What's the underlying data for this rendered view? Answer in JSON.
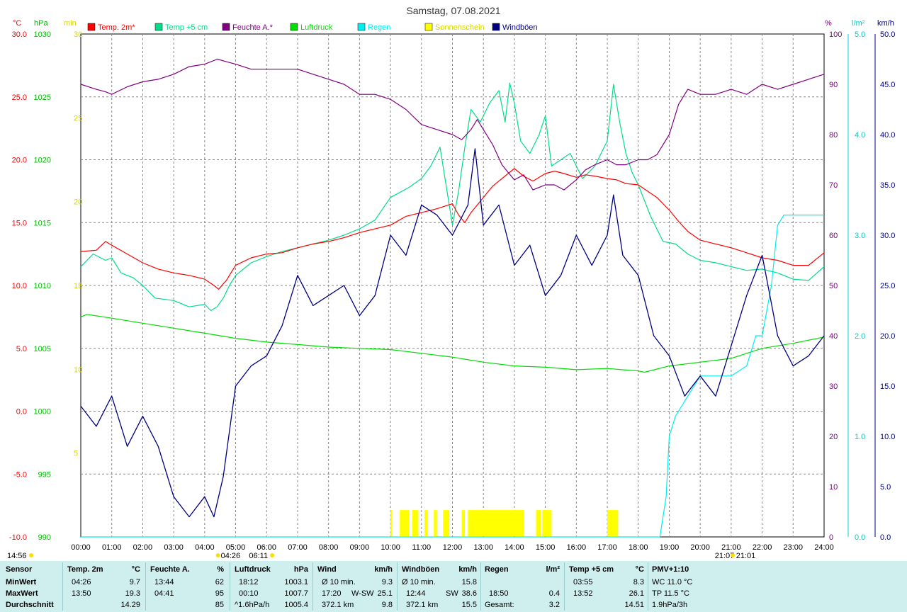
{
  "title": "Samstag, 07.08.2021",
  "colors": {
    "temp2m": "#ff0000",
    "temp5cm": "#00dd88",
    "humidity": "#800080",
    "pressure": "#00dd00",
    "rain": "#00eeee",
    "sunshine": "#ffff00",
    "gusts": "#000080"
  },
  "legend": [
    {
      "label": "Temp. 2m*",
      "color": "#ff0000"
    },
    {
      "label": "Temp +5 cm",
      "color": "#00dd88"
    },
    {
      "label": "Feuchte A.*",
      "color": "#800080"
    },
    {
      "label": "Luftdruck",
      "color": "#00dd00"
    },
    {
      "label": "Regen",
      "color": "#00eeee"
    },
    {
      "label": "Sonnenschein",
      "color": "#ffff00"
    },
    {
      "label": "Windböen",
      "color": "#000080"
    }
  ],
  "axes": {
    "temp": {
      "unit": "°C",
      "ticks": [
        "30.0",
        "25.0",
        "20.0",
        "15.0",
        "10.0",
        "5.0",
        "0.0",
        "-5.0",
        "-10.0"
      ],
      "range": [
        -10,
        30
      ]
    },
    "pressure": {
      "unit": "hPa",
      "ticks": [
        "1030",
        "1025",
        "1020",
        "1015",
        "1010",
        "1005",
        "1000",
        "995",
        "990"
      ],
      "range": [
        990,
        1030
      ]
    },
    "sun_min": {
      "unit": "min",
      "ticks": [
        "30",
        "25",
        "20",
        "15",
        "10",
        "5"
      ],
      "range": [
        0,
        30
      ]
    },
    "humidity": {
      "unit": "%",
      "ticks": [
        "100",
        "90",
        "80",
        "70",
        "60",
        "50",
        "40",
        "30",
        "20",
        "10",
        "0"
      ],
      "range": [
        0,
        100
      ]
    },
    "rain": {
      "unit": "l/m²",
      "ticks": [
        "5.0",
        "4.0",
        "3.0",
        "2.0",
        "1.0",
        "0.0"
      ],
      "range": [
        0,
        5
      ]
    },
    "wind": {
      "unit": "km/h",
      "ticks": [
        "50.0",
        "45.0",
        "40.0",
        "35.0",
        "30.0",
        "25.0",
        "20.0",
        "15.0",
        "10.0",
        "5.0",
        "0.0"
      ],
      "range": [
        0,
        50
      ]
    },
    "time_ticks": [
      "00:00",
      "01:00",
      "02:00",
      "03:00",
      "04:00",
      "05:00",
      "06:00",
      "07:00",
      "08:00",
      "09:00",
      "10:00",
      "11:00",
      "12:00",
      "13:00",
      "14:00",
      "15:00",
      "16:00",
      "17:00",
      "18:00",
      "19:00",
      "20:00",
      "21:00",
      "22:00",
      "23:00",
      "24:00"
    ]
  },
  "time_markers": {
    "left": "14:56",
    "sunrise_a": "04:26",
    "sunrise_b": "06:11",
    "sunset_a": "21:07",
    "sunset_b": "21:01"
  },
  "chart_data": {
    "type": "line",
    "x_unit": "hours",
    "series": [
      {
        "name": "Temp. 2m*",
        "unit": "°C",
        "x": [
          0,
          0.5,
          0.8,
          1,
          1.5,
          2,
          2.5,
          3,
          3.5,
          4,
          4.3,
          4.45,
          4.7,
          5,
          5.5,
          6,
          6.5,
          7,
          7.5,
          8,
          8.5,
          9,
          9.5,
          10,
          10.5,
          11,
          11.5,
          12,
          12.2,
          12.4,
          12.6,
          13,
          13.3,
          13.6,
          14,
          14.3,
          14.6,
          15,
          15.3,
          15.6,
          16,
          16.3,
          16.6,
          17,
          17.3,
          17.6,
          18,
          18.3,
          18.6,
          19,
          19.3,
          19.6,
          20,
          20.5,
          21,
          21.5,
          22,
          22.5,
          23,
          23.5,
          24
        ],
        "y": [
          12.7,
          12.8,
          13.5,
          13.2,
          12.5,
          11.8,
          11.3,
          11.0,
          10.8,
          10.5,
          10.0,
          9.7,
          10.4,
          11.6,
          12.2,
          12.5,
          12.6,
          13.0,
          13.3,
          13.5,
          13.8,
          14.2,
          14.5,
          14.8,
          15.5,
          15.8,
          16.1,
          16.5,
          15.6,
          15.0,
          15.8,
          17.0,
          17.9,
          18.5,
          19.3,
          18.7,
          18.3,
          18.9,
          19.1,
          18.9,
          18.6,
          18.8,
          18.7,
          18.5,
          18.4,
          18.1,
          18.0,
          17.5,
          17.0,
          16.0,
          15.1,
          14.3,
          13.6,
          13.3,
          13.0,
          12.6,
          12.2,
          12.0,
          11.6,
          11.6,
          12.6
        ]
      },
      {
        "name": "Temp +5 cm",
        "unit": "°C",
        "x": [
          0,
          0.4,
          0.8,
          1,
          1.3,
          1.7,
          2,
          2.4,
          3,
          3.5,
          4,
          4.2,
          4.4,
          4.6,
          4.8,
          5,
          5.5,
          6,
          6.5,
          7,
          7.5,
          8,
          8.5,
          9,
          9.5,
          10,
          10.3,
          10.6,
          11,
          11.3,
          11.6,
          12,
          12.2,
          12.4,
          12.6,
          12.9,
          13.2,
          13.5,
          13.7,
          13.85,
          14,
          14.2,
          14.5,
          14.8,
          15,
          15.2,
          15.5,
          15.8,
          16.2,
          16.6,
          17,
          17.2,
          17.4,
          17.6,
          17.8,
          18,
          18.4,
          18.8,
          19.2,
          19.6,
          20,
          20.5,
          21,
          21.5,
          22,
          22.5,
          23,
          23.5,
          24
        ],
        "y": [
          11.5,
          12.5,
          12.0,
          12.2,
          11.0,
          10.6,
          10.0,
          9.0,
          8.8,
          8.3,
          8.5,
          8.0,
          8.3,
          9.0,
          10.0,
          10.8,
          11.8,
          12.3,
          12.7,
          13.0,
          13.3,
          13.6,
          14.0,
          14.5,
          15.2,
          17.0,
          17.4,
          17.8,
          18.5,
          19.5,
          21.0,
          14.8,
          17.5,
          21.0,
          24.0,
          23.0,
          24.5,
          25.5,
          23.0,
          26.1,
          24.5,
          21.5,
          20.5,
          22.0,
          23.5,
          19.5,
          20.0,
          20.5,
          18.5,
          19.5,
          21.5,
          26.0,
          23.0,
          20.5,
          19.0,
          18.0,
          15.5,
          13.5,
          13.3,
          12.5,
          12.0,
          11.8,
          11.5,
          11.2,
          11.3,
          11.0,
          10.5,
          10.4,
          11.5
        ]
      },
      {
        "name": "Feuchte A.*",
        "unit": "%",
        "x": [
          0,
          0.5,
          0.8,
          1,
          1.5,
          2,
          2.5,
          3,
          3.5,
          4,
          4.41,
          4.7,
          5,
          5.5,
          6,
          6.5,
          7,
          7.5,
          8,
          8.5,
          9,
          9.5,
          10,
          10.5,
          11,
          11.5,
          12,
          12.3,
          12.6,
          12.8,
          13,
          13.3,
          13.6,
          13.73,
          14,
          14.3,
          14.6,
          15,
          15.3,
          15.6,
          16,
          16.3,
          16.6,
          17,
          17.3,
          17.6,
          18,
          18.3,
          18.6,
          19,
          19.3,
          19.6,
          20,
          20.5,
          21,
          21.5,
          22,
          22.5,
          23,
          23.5,
          24
        ],
        "y": [
          90,
          89,
          88.5,
          88,
          89.5,
          90.5,
          91,
          92,
          93.5,
          94,
          95,
          94.5,
          94,
          93,
          93,
          93,
          93,
          92,
          91,
          90,
          88,
          88,
          87,
          85,
          82,
          81,
          80,
          79,
          81,
          83,
          81,
          78,
          74,
          73,
          71,
          72,
          69,
          70,
          70,
          69,
          71,
          73,
          74,
          75,
          74,
          74,
          75,
          75,
          76,
          80,
          86,
          89,
          88,
          88,
          89,
          88,
          90,
          89,
          90,
          91,
          92
        ]
      },
      {
        "name": "Luftdruck",
        "unit": "hPa",
        "x": [
          0,
          0.2,
          1,
          2,
          3,
          4,
          5,
          6,
          7,
          8,
          9,
          10,
          11,
          12,
          13,
          14,
          15,
          16,
          17,
          18,
          18.2,
          19,
          20,
          21,
          22,
          23,
          24
        ],
        "y": [
          1007.5,
          1007.7,
          1007.4,
          1007.0,
          1006.6,
          1006.2,
          1005.8,
          1005.5,
          1005.3,
          1005.1,
          1005.0,
          1004.9,
          1004.6,
          1004.3,
          1003.9,
          1003.6,
          1003.5,
          1003.3,
          1003.4,
          1003.2,
          1003.1,
          1003.6,
          1003.9,
          1004.2,
          1005.0,
          1005.4,
          1005.9
        ]
      },
      {
        "name": "Regen",
        "unit": "l/m²",
        "x": [
          0,
          18.7,
          18.8,
          18.9,
          19.0,
          19.2,
          20.0,
          20.5,
          21.0,
          21.5,
          21.8,
          22.0,
          22.3,
          22.5,
          22.7,
          23.0,
          24.0
        ],
        "y": [
          0,
          0,
          0.2,
          0.4,
          1.0,
          1.2,
          1.6,
          1.6,
          1.6,
          1.7,
          2.0,
          2.0,
          2.5,
          3.1,
          3.2,
          3.2,
          3.2
        ]
      },
      {
        "name": "Windböen",
        "unit": "km/h",
        "x": [
          0,
          0.5,
          1,
          1.5,
          2,
          2.5,
          3,
          3.5,
          4,
          4.3,
          4.6,
          5,
          5.5,
          6,
          6.5,
          7,
          7.5,
          8,
          8.5,
          9,
          9.5,
          10,
          10.5,
          11,
          11.5,
          12,
          12.5,
          12.73,
          13,
          13.5,
          14,
          14.5,
          15,
          15.5,
          16,
          16.5,
          17,
          17.2,
          17.5,
          18,
          18.5,
          19,
          19.5,
          20,
          20.5,
          21,
          21.5,
          22,
          22.5,
          23,
          23.5,
          24
        ],
        "y": [
          13,
          11,
          14,
          9,
          12,
          9,
          4,
          2,
          4,
          2,
          6,
          15,
          17,
          18,
          21,
          26,
          23,
          24,
          25,
          22,
          24,
          30,
          28,
          33,
          32,
          30,
          33,
          38.6,
          31,
          33,
          27,
          29,
          24,
          26,
          30,
          27,
          30,
          34,
          28,
          26,
          20,
          18,
          14,
          16,
          14,
          19,
          24,
          28,
          20,
          17,
          18,
          20
        ]
      },
      {
        "name": "Sonnenschein",
        "unit": "min",
        "intervals": [
          [
            10.0,
            10.05
          ],
          [
            10.3,
            10.6
          ],
          [
            10.7,
            10.9
          ],
          [
            11.1,
            11.2
          ],
          [
            11.4,
            11.5
          ],
          [
            11.7,
            11.9
          ],
          [
            12.3,
            12.4
          ],
          [
            12.5,
            14.3
          ],
          [
            14.7,
            14.85
          ],
          [
            14.9,
            15.2
          ],
          [
            17.0,
            17.35
          ]
        ]
      }
    ]
  },
  "stats": {
    "headers": {
      "sensor": "Sensor",
      "temp2m": "Temp. 2m",
      "temp2m_unit": "°C",
      "hum": "Feuchte A.",
      "hum_unit": "%",
      "press": "Luftdruck",
      "press_unit": "hPa",
      "wind": "Wind",
      "wind_unit": "km/h",
      "gust": "Windböen",
      "gust_unit": "km/h",
      "rain": "Regen",
      "rain_unit": "l/m²",
      "temp5": "Temp +5 cm",
      "temp5_unit": "°C",
      "pmv": "PMV+1:10"
    },
    "row_labels": [
      "MinWert",
      "MaxWert",
      "Durchschnitt"
    ],
    "temp2m": {
      "min_time": "04:26",
      "min": "9.7",
      "max_time": "13:50",
      "max": "19.3",
      "avg": "14.29"
    },
    "hum": {
      "min_time": "13:44",
      "min": "62",
      "max_time": "04:41",
      "max": "95",
      "avg": "85"
    },
    "press": {
      "min_time": "18:12",
      "min": "1003.1",
      "max_time": "00:10",
      "max": "1007.7",
      "trend": "^1.6hPa/h",
      "avg": "1005.4"
    },
    "wind": {
      "min_label": "Ø 10 min.",
      "min": "9.3",
      "max_time": "17:20",
      "max_dir": "W-SW",
      "max": "25.1",
      "dist": "372.1 km",
      "avg": "9.8"
    },
    "gust": {
      "min_label": "Ø 10 min.",
      "min": "15.8",
      "max_time": "12:44",
      "max_dir": "SW",
      "max": "38.6",
      "dist": "372.1 km",
      "avg": "15.5"
    },
    "rain": {
      "max_time": "18:50",
      "max": "0.4",
      "total_label": "Gesamt:",
      "total": "3.2"
    },
    "temp5": {
      "min_time": "03:55",
      "min": "8.3",
      "max_time": "13:52",
      "max": "26.1",
      "avg": "14.51"
    },
    "pmv": {
      "wc": "WC 11.0 °C",
      "tp": "TP 11.5 °C",
      "trend": "1.9hPa/3h"
    }
  }
}
